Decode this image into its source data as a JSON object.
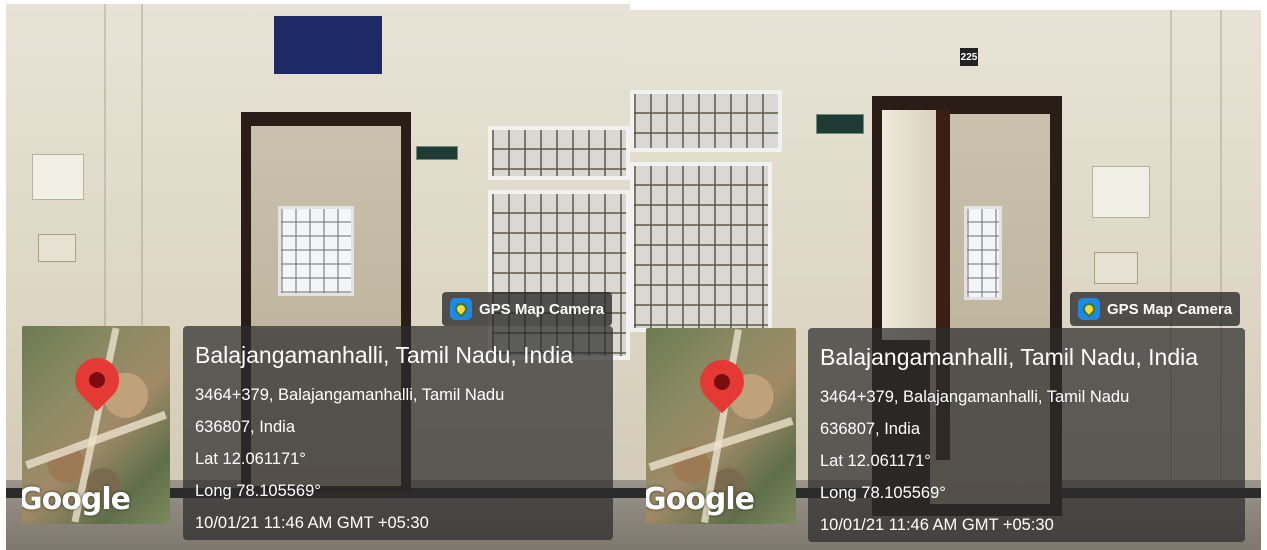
{
  "photos": [
    {
      "gps_badge": {
        "label": "GPS Map Camera",
        "icon": "gps-map-camera-app-icon"
      },
      "map": {
        "logo": "Google",
        "marker": "map-pin-icon",
        "marker_color": "#e53935"
      },
      "info": {
        "title": "Balajangamanhalli, Tamil Nadu, India",
        "address_line1": "3464+379, Balajangamanhalli, Tamil Nadu",
        "address_line2": "636807, India",
        "lat": "Lat 12.061171°",
        "long": "Long 78.105569°",
        "datetime": "10/01/21 11:46 AM GMT +05:30"
      }
    },
    {
      "room_number": "225",
      "gps_badge": {
        "label": "GPS Map Camera",
        "icon": "gps-map-camera-app-icon"
      },
      "map": {
        "logo": "Google",
        "marker": "map-pin-icon",
        "marker_color": "#e53935"
      },
      "info": {
        "title": "Balajangamanhalli, Tamil Nadu, India",
        "address_line1": "3464+379, Balajangamanhalli, Tamil Nadu",
        "address_line2": "636807, India",
        "lat": "Lat 12.061171°",
        "long": "Long 78.105569°",
        "datetime": "10/01/21 11:46 AM GMT +05:30"
      }
    }
  ]
}
